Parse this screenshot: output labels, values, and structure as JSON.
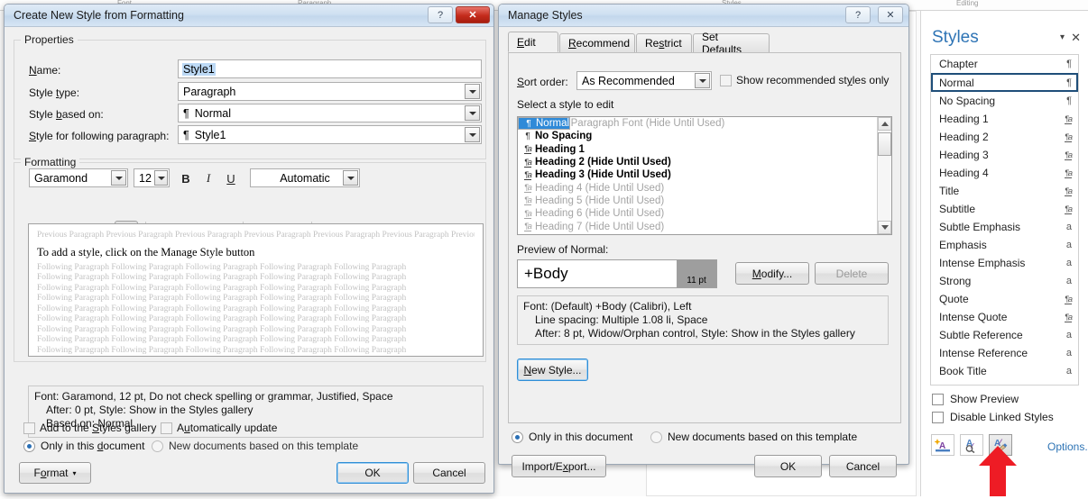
{
  "background": {
    "ribbon_labels": [
      "Font",
      "Paragraph",
      "Styles",
      "Editing"
    ]
  },
  "create_style_dialog": {
    "title": "Create New Style from Formatting",
    "titlebar": {
      "help": "?",
      "close": "✕"
    },
    "properties": {
      "caption": "Properties",
      "name_label": "Name:",
      "name_value": "Style1",
      "style_type_label": "Style type:",
      "style_type_value": "Paragraph",
      "based_on_label": "Style based on:",
      "based_on_value": "Normal",
      "based_on_icon": "¶",
      "following_label": "Style for following paragraph:",
      "following_value": "Style1",
      "following_icon": "¶"
    },
    "formatting": {
      "caption": "Formatting",
      "font_family": "Garamond",
      "font_size": "12",
      "bold": "B",
      "italic": "I",
      "underline": "U",
      "font_color": "Automatic",
      "align_left": "align-left",
      "align_center": "align-center",
      "align_right": "align-right",
      "align_justify": "align-justify",
      "spacing_1": "line-spacing-single",
      "spacing_15": "line-spacing-1.5",
      "spacing_2": "line-spacing-double",
      "space_before": "space-before",
      "space_after": "space-after",
      "indent_decrease": "decrease-indent",
      "indent_increase": "increase-indent"
    },
    "preview": {
      "previous_paragraph": "Previous Paragraph Previous Paragraph Previous Paragraph Previous Paragraph Previous Paragraph Previous Paragraph Previous Paragraph Previous Paragraph Previous Paragraph Previous Paragraph",
      "sample_line": "To add a style, click on the Manage Style button",
      "following_paragraph": "Following Paragraph Following Paragraph Following Paragraph Following Paragraph Following Paragraph"
    },
    "description": {
      "line1": "Font: Garamond, 12 pt, Do not check spelling or grammar, Justified, Space",
      "line2": "After:  0 pt, Style: Show in the Styles gallery",
      "line3": "Based on: Normal"
    },
    "options": {
      "add_to_gallery": "Add to the Styles gallery",
      "add_to_gallery_checked": false,
      "auto_update": "Automatically update",
      "auto_update_checked": false,
      "only_this_document": "Only in this document",
      "new_documents": "New documents based on this template",
      "scope_selected": "only_this_document"
    },
    "buttons": {
      "format": "Format",
      "ok": "OK",
      "cancel": "Cancel"
    }
  },
  "manage_styles_dialog": {
    "title": "Manage Styles",
    "titlebar": {
      "help": "?",
      "close": "✕"
    },
    "tabs": [
      {
        "label": "Edit",
        "active": true
      },
      {
        "label": "Recommend",
        "active": false
      },
      {
        "label": "Restrict",
        "active": false
      },
      {
        "label": "Set Defaults",
        "active": false
      }
    ],
    "sort_order_label": "Sort order:",
    "sort_order_value": "As Recommended",
    "show_recommended_label": "Show recommended styles only",
    "show_recommended_checked": false,
    "select_label": "Select a style to edit",
    "style_list": [
      {
        "icon": "¶",
        "name": "Normal",
        "note": "",
        "selected": true,
        "bold": false,
        "dim": false
      },
      {
        "icon": "a",
        "name": "Default Paragraph Font",
        "note": "(Hide Until Used)",
        "selected": false,
        "bold": false,
        "dim": true
      },
      {
        "icon": "¶",
        "name": "No Spacing",
        "note": "",
        "selected": false,
        "bold": true,
        "dim": false
      },
      {
        "icon": "¶a",
        "name": "Heading 1",
        "note": "",
        "selected": false,
        "bold": true,
        "dim": false
      },
      {
        "icon": "¶a",
        "name": "Heading 2",
        "note": "(Hide Until Used)",
        "selected": false,
        "bold": true,
        "dim": false
      },
      {
        "icon": "¶a",
        "name": "Heading 3",
        "note": "(Hide Until Used)",
        "selected": false,
        "bold": true,
        "dim": false
      },
      {
        "icon": "¶a",
        "name": "Heading 4",
        "note": "(Hide Until Used)",
        "selected": false,
        "bold": false,
        "dim": true
      },
      {
        "icon": "¶a",
        "name": "Heading 5",
        "note": "(Hide Until Used)",
        "selected": false,
        "bold": false,
        "dim": true
      },
      {
        "icon": "¶a",
        "name": "Heading 6",
        "note": "(Hide Until Used)",
        "selected": false,
        "bold": false,
        "dim": true
      },
      {
        "icon": "¶a",
        "name": "Heading 7",
        "note": "(Hide Until Used)",
        "selected": false,
        "bold": false,
        "dim": true
      }
    ],
    "preview_label": "Preview of Normal:",
    "preview_font": "+Body",
    "preview_size": "11 pt",
    "modify_button": "Modify...",
    "delete_button": "Delete",
    "delete_disabled": true,
    "description": {
      "line1": "Font: (Default) +Body (Calibri), Left",
      "line2": "Line spacing:  Multiple 1.08 li, Space",
      "line3": "After:  8 pt, Widow/Orphan control, Style: Show in the Styles gallery"
    },
    "new_style_button": "New Style...",
    "scope": {
      "only_this_document": "Only in this document",
      "new_documents": "New documents based on this template",
      "selected": "only_this_document"
    },
    "buttons": {
      "import_export": "Import/Export...",
      "ok": "OK",
      "cancel": "Cancel"
    }
  },
  "styles_pane": {
    "title": "Styles",
    "collapse_icon": "▾",
    "close_icon": "✕",
    "items": [
      {
        "name": "Chapter",
        "icon": "¶",
        "active": false
      },
      {
        "name": "Normal",
        "icon": "¶",
        "active": true
      },
      {
        "name": "No Spacing",
        "icon": "¶",
        "active": false
      },
      {
        "name": "Heading 1",
        "icon": "¶a",
        "active": false
      },
      {
        "name": "Heading 2",
        "icon": "¶a",
        "active": false
      },
      {
        "name": "Heading 3",
        "icon": "¶a",
        "active": false
      },
      {
        "name": "Heading 4",
        "icon": "¶a",
        "active": false
      },
      {
        "name": "Title",
        "icon": "¶a",
        "active": false
      },
      {
        "name": "Subtitle",
        "icon": "¶a",
        "active": false
      },
      {
        "name": "Subtle Emphasis",
        "icon": "a",
        "active": false
      },
      {
        "name": "Emphasis",
        "icon": "a",
        "active": false
      },
      {
        "name": "Intense Emphasis",
        "icon": "a",
        "active": false
      },
      {
        "name": "Strong",
        "icon": "a",
        "active": false
      },
      {
        "name": "Quote",
        "icon": "¶a",
        "active": false
      },
      {
        "name": "Intense Quote",
        "icon": "¶a",
        "active": false
      },
      {
        "name": "Subtle Reference",
        "icon": "a",
        "active": false
      },
      {
        "name": "Intense Reference",
        "icon": "a",
        "active": false
      },
      {
        "name": "Book Title",
        "icon": "a",
        "active": false
      }
    ],
    "show_preview": "Show Preview",
    "show_preview_checked": false,
    "disable_linked": "Disable Linked Styles",
    "disable_linked_checked": false,
    "footer_buttons": [
      {
        "name": "new-style-button",
        "active": false
      },
      {
        "name": "style-inspector-button",
        "active": false
      },
      {
        "name": "manage-styles-button",
        "active": true
      }
    ],
    "options_link": "Options..."
  },
  "annotation": {
    "arrow_color": "#ee1c25"
  }
}
